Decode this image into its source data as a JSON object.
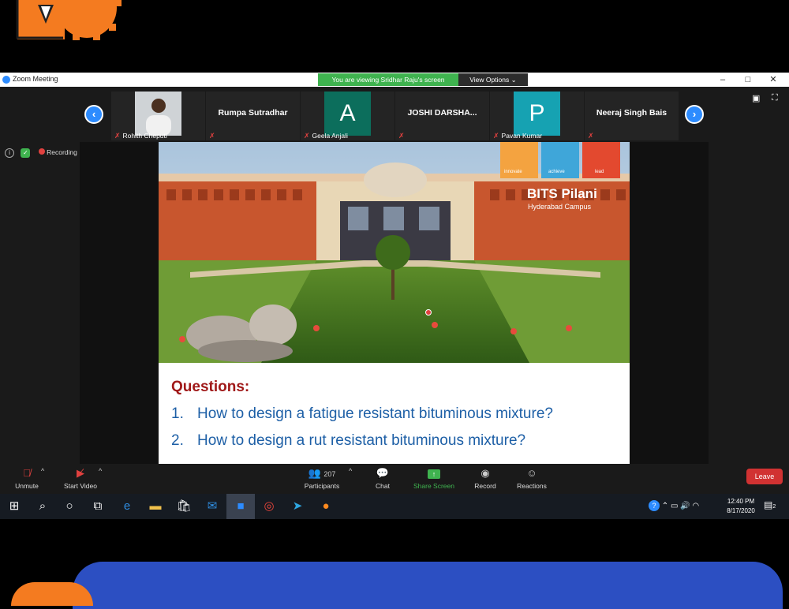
{
  "window": {
    "app_title": "Zoom Meeting",
    "viewing_banner": "You are viewing Sridhar Raju's screen",
    "view_options": "View Options",
    "controls": [
      "–",
      "□",
      "✕"
    ]
  },
  "participants": [
    {
      "name": "Rohith Cheputi",
      "type": "video",
      "center_name": ""
    },
    {
      "name": "",
      "type": "name",
      "center_name": "Rumpa Sutradhar"
    },
    {
      "name": "Geela Anjali",
      "type": "avatar",
      "letter": "A",
      "color": "#0c6e5c",
      "center_name": ""
    },
    {
      "name": "",
      "type": "name",
      "center_name": "JOSHI  DARSHA..."
    },
    {
      "name": "Pavan Kumar",
      "type": "avatar",
      "letter": "P",
      "color": "#16a2b2",
      "center_name": ""
    },
    {
      "name": "",
      "type": "name",
      "center_name": "Neeraj Singh Bais"
    }
  ],
  "status": {
    "recording": "Recording"
  },
  "slide": {
    "brand_tags": [
      "innovate",
      "achieve",
      "lead"
    ],
    "brand_name": "BITS Pilani",
    "brand_sub": "Hyderabad Campus",
    "questions_title": "Questions:",
    "questions": [
      {
        "num": "1.",
        "text": "How to design a fatigue resistant bituminous mixture?"
      },
      {
        "num": "2.",
        "text": "How to design a rut resistant bituminous mixture?"
      }
    ]
  },
  "toolbar": {
    "unmute": "Unmute",
    "start_video": "Start Video",
    "participants": "Participants",
    "participants_count": "207",
    "chat": "Chat",
    "share_screen": "Share Screen",
    "record": "Record",
    "reactions": "Reactions",
    "leave": "Leave"
  },
  "taskbar": {
    "time": "12:40 PM",
    "date": "8/17/2020",
    "notifications": "2"
  },
  "colors": {
    "share_green": "#3fb34f",
    "leave_red": "#d13232",
    "zoom_blue": "#2d8cff",
    "question_red": "#a01919",
    "question_blue": "#1d5fa6"
  }
}
